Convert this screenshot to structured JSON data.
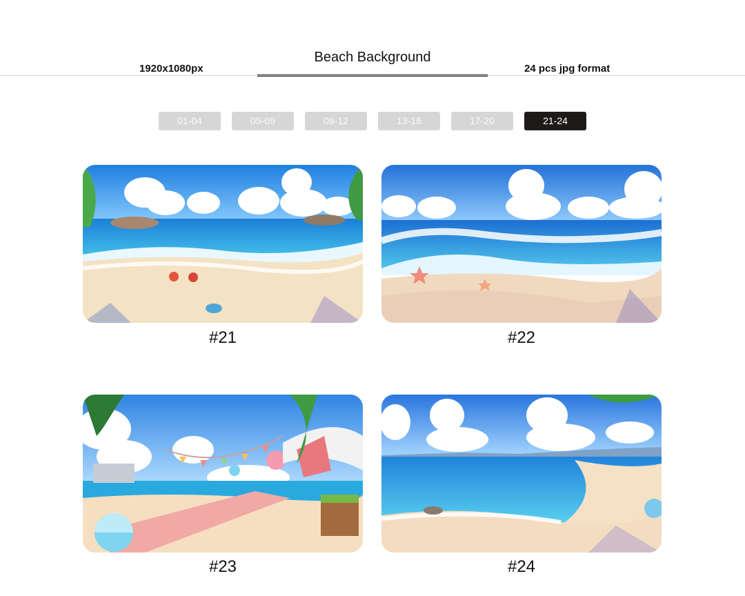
{
  "header": {
    "resolution": "1920x1080px",
    "title": "Beach Background",
    "format": "24 pcs jpg format"
  },
  "pager": {
    "ranges": [
      "01-04",
      "05-09",
      "09-12",
      "13-16",
      "17-20",
      "21-24"
    ],
    "active": "21-24"
  },
  "gallery": {
    "items": [
      {
        "caption": "#21",
        "scene": "beach with palm trees and shells"
      },
      {
        "caption": "#22",
        "scene": "waves and starfish on shore"
      },
      {
        "caption": "#23",
        "scene": "beach umbrella, beach ball and bunting"
      },
      {
        "caption": "#24",
        "scene": "curving shoreline with distant town"
      }
    ]
  },
  "colors": {
    "active_button": "#1f1a1a",
    "inactive_button": "#d6d6d6",
    "sky": "#3b8fe6",
    "sea": "#2fb6e8",
    "sand": "#f5deb8"
  }
}
